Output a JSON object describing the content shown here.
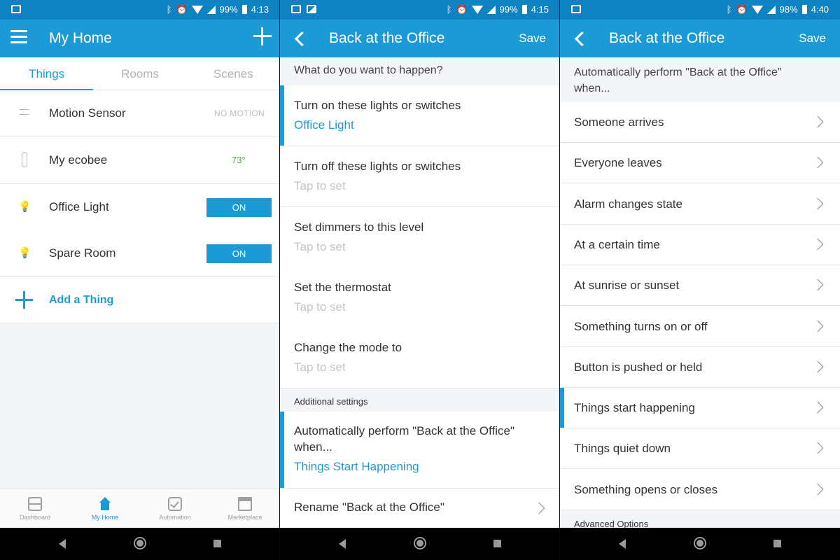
{
  "colors": {
    "accent": "#1c9ad6",
    "status_bar": "#0f83c2",
    "on_green": "#4caa3c"
  },
  "screens": [
    {
      "status": {
        "battery": "99%",
        "time": "4:13"
      },
      "appbar": {
        "title": "My Home"
      },
      "tabs": [
        "Things",
        "Rooms",
        "Scenes"
      ],
      "things": [
        {
          "label": "Motion Sensor",
          "status": "NO MOTION",
          "icon": "swap-arrows-icon"
        },
        {
          "label": "My ecobee",
          "status": "73°",
          "icon": "thermometer-icon"
        },
        {
          "label": "Office Light",
          "status": "ON",
          "icon": "lightbulb-icon"
        },
        {
          "label": "Spare Room",
          "status": "ON",
          "icon": "lightbulb-icon"
        }
      ],
      "add_thing": "Add a Thing",
      "bottom_nav": [
        "Dashboard",
        "My Home",
        "Automation",
        "Marketplace"
      ]
    },
    {
      "status": {
        "battery": "99%",
        "time": "4:15"
      },
      "appbar": {
        "title": "Back at the Office",
        "action": "Save"
      },
      "question": "What do you want to happen?",
      "actions": [
        {
          "label": "Turn on these lights or switches",
          "value": "Office Light"
        },
        {
          "label": "Turn off these lights or switches",
          "value": "Tap to set"
        },
        {
          "label": "Set dimmers to this level",
          "value": "Tap to set"
        },
        {
          "label": "Set the thermostat",
          "value": "Tap to set"
        },
        {
          "label": "Change the mode to",
          "value": "Tap to set"
        }
      ],
      "additional_header": "Additional settings",
      "auto_perform": {
        "label_line1": "Automatically perform \"Back at the Office\"",
        "label_line2": "when...",
        "value": "Things Start Happening"
      },
      "rename": "Rename \"Back at the Office\""
    },
    {
      "status": {
        "battery": "98%",
        "time": "4:40"
      },
      "appbar": {
        "title": "Back at the Office",
        "action": "Save"
      },
      "header_line1": "Automatically perform \"Back at the Office\"",
      "header_line2": "when...",
      "triggers": [
        "Someone arrives",
        "Everyone leaves",
        "Alarm changes state",
        "At a certain time",
        "At sunrise or sunset",
        "Something turns on or off",
        "Button is pushed or held",
        "Things start happening",
        "Things quiet down",
        "Something opens or closes"
      ],
      "selected_trigger_index": 7,
      "advanced_header": "Advanced Options"
    }
  ]
}
